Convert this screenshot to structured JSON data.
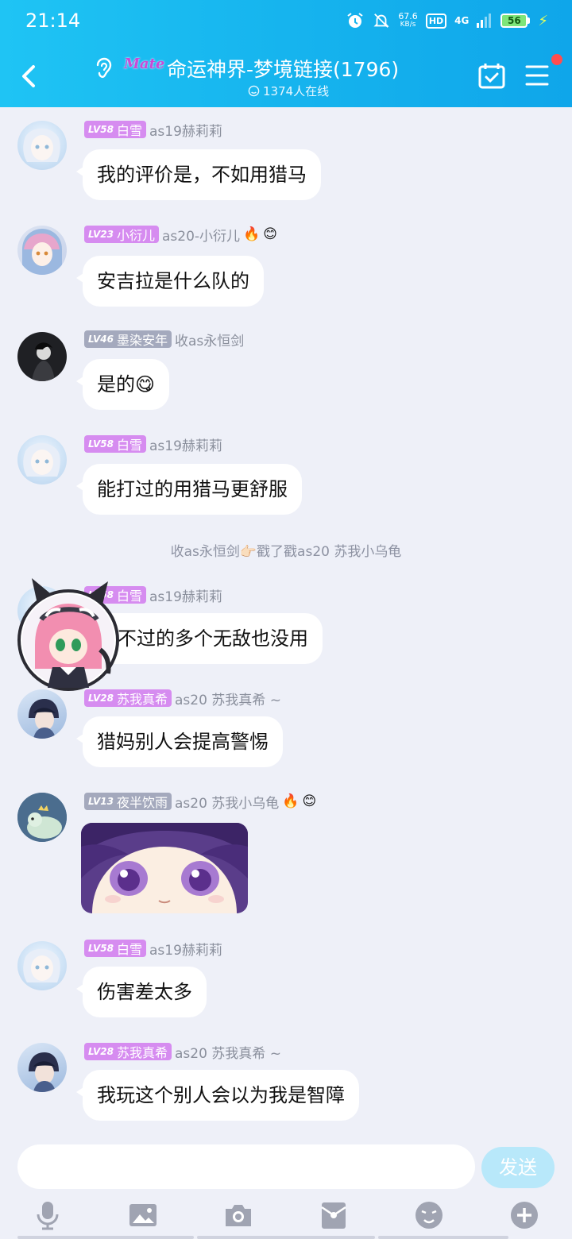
{
  "status_bar": {
    "time": "21:14",
    "speed_value": "67.6",
    "speed_unit": "KB/s",
    "hd": "HD",
    "network": "4G",
    "battery": "56"
  },
  "header": {
    "logo_text": "Mate",
    "title": "命运神界-梦境链接(1796)",
    "online": "1374人在线"
  },
  "messages": [
    {
      "level": "LV58",
      "name": "白雪",
      "sub": "as19赫莉莉",
      "text": "我的评价是，不如用猎马"
    },
    {
      "level": "LV23",
      "name": "小衍儿",
      "sub": "as20-小衍儿",
      "text": "安吉拉是什么队的"
    },
    {
      "level": "LV46",
      "name": "墨染安年",
      "sub": "收as永恒剑",
      "text": "是的😋"
    },
    {
      "level": "LV58",
      "name": "白雪",
      "sub": "as19赫莉莉",
      "text": "能打过的用猎马更舒服"
    },
    {
      "level": "LV58",
      "name": "白雪",
      "sub": "as19赫莉莉",
      "text": "不过的多个无敌也没用"
    },
    {
      "level": "LV28",
      "name": "苏我真希",
      "sub": "as20 苏我真希 ~",
      "text": "猎妈别人会提高警惕"
    },
    {
      "level": "LV13",
      "name": "夜半饮雨",
      "sub": "as20 苏我小乌龟",
      "text": ""
    },
    {
      "level": "LV58",
      "name": "白雪",
      "sub": "as19赫莉莉",
      "text": "伤害差太多"
    },
    {
      "level": "LV28",
      "name": "苏我真希",
      "sub": "as20 苏我真希 ~",
      "text": "我玩这个别人会以为我是智障"
    }
  ],
  "system_notice": "收as永恒剑👉🏻戳了戳as20 苏我小乌龟",
  "input": {
    "placeholder": "",
    "send": "发送"
  },
  "toolbar_icons": [
    "mic-icon",
    "image-icon",
    "camera-icon",
    "red-packet-icon",
    "emoji-icon",
    "plus-icon"
  ],
  "colors": {
    "header": "#16b4ee",
    "level_pink": "#d68cf0",
    "level_gray": "#a4a9bd",
    "send_disabled": "#b8e8fa"
  }
}
